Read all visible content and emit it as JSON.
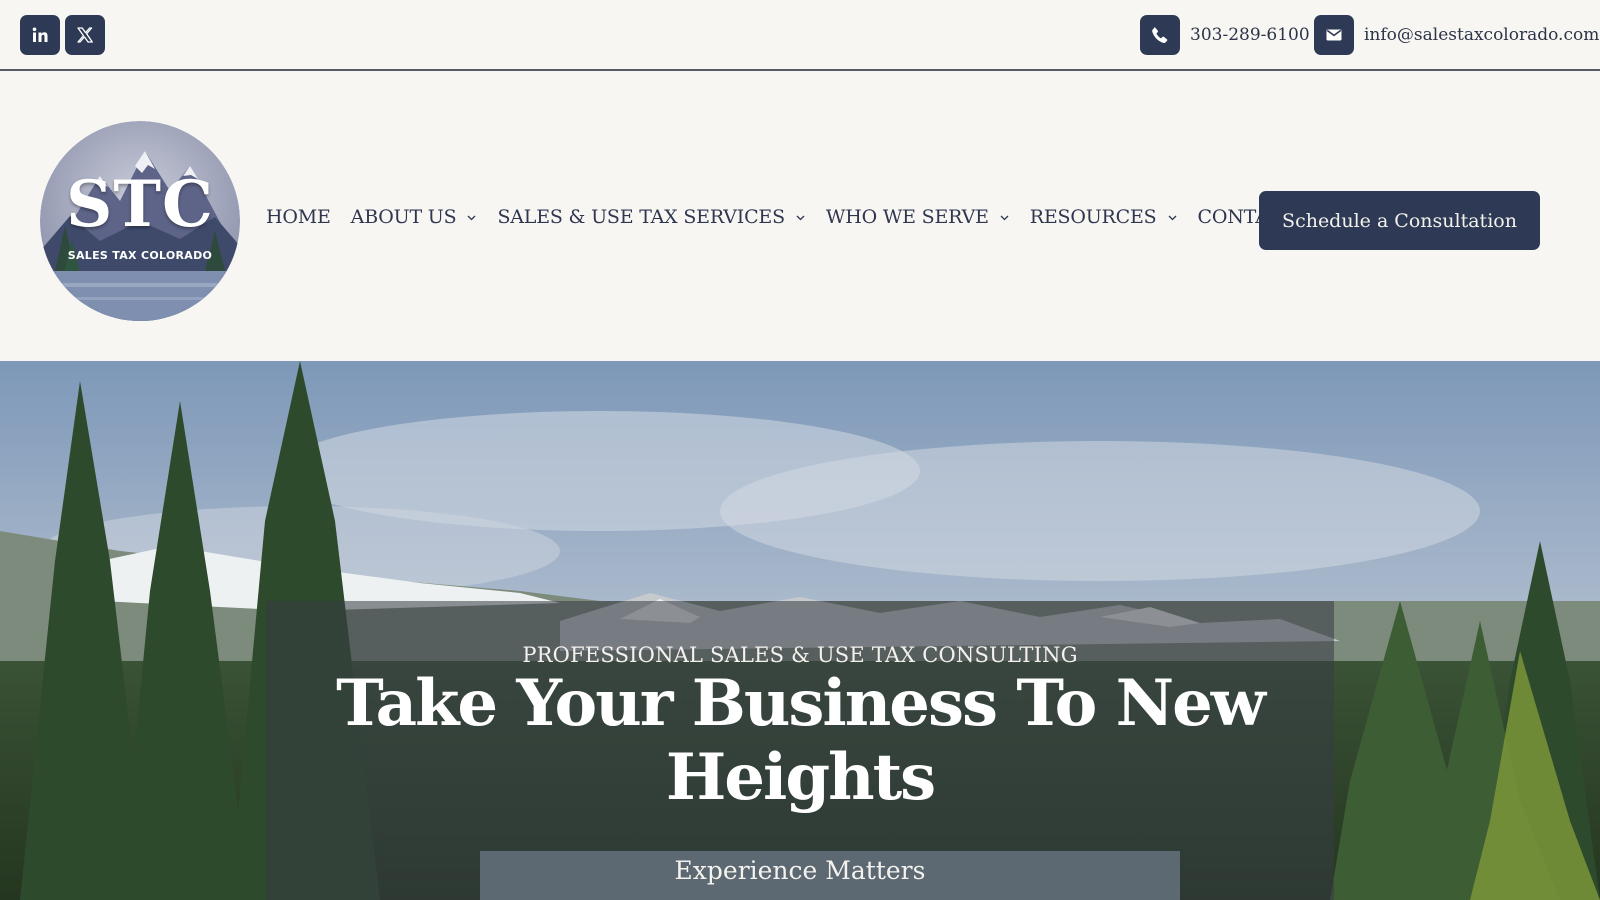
{
  "topbar": {
    "social": [
      {
        "name": "linkedin-icon",
        "glyph": "in"
      },
      {
        "name": "x-icon",
        "glyph": "X"
      }
    ],
    "phone": "303-289-6100",
    "email": "info@salestaxcolorado.com"
  },
  "header": {
    "logo": {
      "initials": "STC",
      "subtitle": "SALES TAX COLORADO"
    },
    "nav": [
      {
        "label": "HOME",
        "dropdown": false
      },
      {
        "label": "ABOUT US",
        "dropdown": true
      },
      {
        "label": "SALES & USE TAX SERVICES",
        "dropdown": true
      },
      {
        "label": "WHO WE SERVE",
        "dropdown": true
      },
      {
        "label": "RESOURCES",
        "dropdown": true
      },
      {
        "label": "CONTACT",
        "dropdown": false
      }
    ],
    "cta_label": "Schedule a Consultation"
  },
  "hero": {
    "eyebrow": "PROFESSIONAL SALES & USE TAX CONSULTING",
    "headline": "Take Your Business To New Heights",
    "tagline": "Experience Matters"
  },
  "colors": {
    "navy": "#2e3a55",
    "background": "#f8f6f2",
    "text": "#2e3650"
  }
}
